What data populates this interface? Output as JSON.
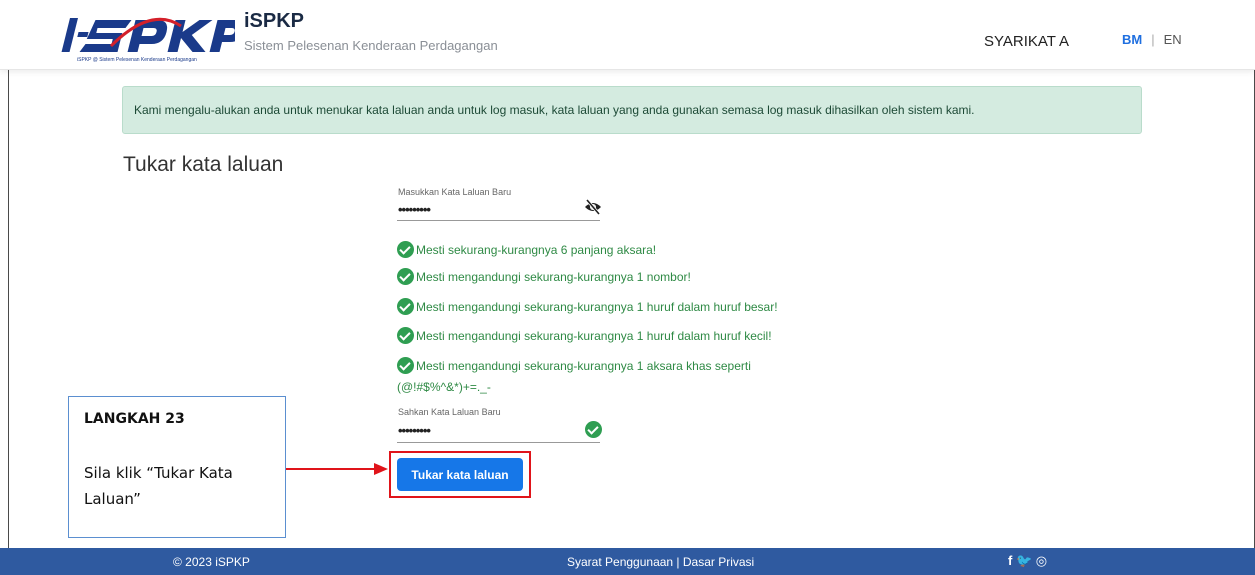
{
  "header": {
    "logo_text": "i-SPKP",
    "title": "iSPKP",
    "subtitle": "Sistem Pelesenan Kenderaan Perdagangan",
    "company": "SYARIKAT A",
    "lang_bm": "BM",
    "lang_sep": "|",
    "lang_en": "EN"
  },
  "alert": {
    "text": "Kami mengalu-alukan anda untuk menukar kata laluan anda untuk log masuk, kata laluan yang anda gunakan semasa log masuk dihasilkan oleh sistem kami."
  },
  "form": {
    "title": "Tukar kata laluan",
    "new_password_label": "Masukkan Kata Laluan Baru",
    "new_password_value": "•••••••••",
    "confirm_password_label": "Sahkan Kata Laluan Baru",
    "confirm_password_value": "•••••••••",
    "rules": [
      "Mesti sekurang-kurangnya 6 panjang aksara!",
      "Mesti mengandungi sekurang-kurangnya 1 nombor!",
      "Mesti mengandungi sekurang-kurangnya 1 huruf dalam huruf besar!",
      "Mesti mengandungi sekurang-kurangnya 1 huruf dalam huruf kecil!",
      "Mesti mengandungi sekurang-kurangnya 1 aksara khas seperti"
    ],
    "rule_special_chars": "(@!#$%^&*)+=._-",
    "submit_label": "Tukar kata laluan"
  },
  "callout": {
    "step": "LANGKAH 23",
    "instruction": "Sila klik “Tukar Kata Laluan”"
  },
  "footer": {
    "copyright": "© 2023 iSPKP",
    "links": "Syarat Penggunaan | Dasar Privasi",
    "social": "f 🐦 ◎"
  },
  "colors": {
    "primary": "#1677e8",
    "success": "#2f9e52",
    "alert_bg": "#d4ebe0",
    "footer_bg": "#2f5aa0",
    "highlight": "#e0141a"
  }
}
